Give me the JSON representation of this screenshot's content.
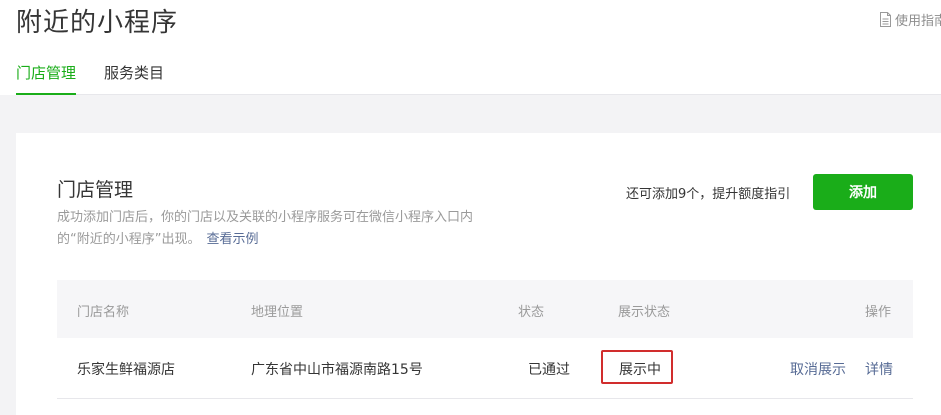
{
  "header": {
    "title": "附近的小程序",
    "guide_label": "使用指南"
  },
  "tabs": [
    {
      "label": "门店管理",
      "active": true
    },
    {
      "label": "服务类目",
      "active": false
    }
  ],
  "card": {
    "title": "门店管理",
    "description": "成功添加门店后，你的门店以及关联的小程序服务可在微信小程序入口内的“附近的小程序”出现。",
    "example_link": "查看示例",
    "quota_text": "还可添加9个，提升额度指引",
    "add_button": "添加"
  },
  "table": {
    "columns": [
      "门店名称",
      "地理位置",
      "状态",
      "展示状态",
      "操作"
    ],
    "rows": [
      {
        "name": "乐家生鲜福源店",
        "location": "广东省中山市福源南路15号",
        "status": "已通过",
        "display_status": "展示中",
        "actions": [
          "取消展示",
          "详情"
        ]
      }
    ]
  },
  "colors": {
    "accent": "#1aad19",
    "link": "#576b95",
    "highlight_border": "#d12d2d"
  },
  "icons": {
    "guide": "document-icon"
  }
}
